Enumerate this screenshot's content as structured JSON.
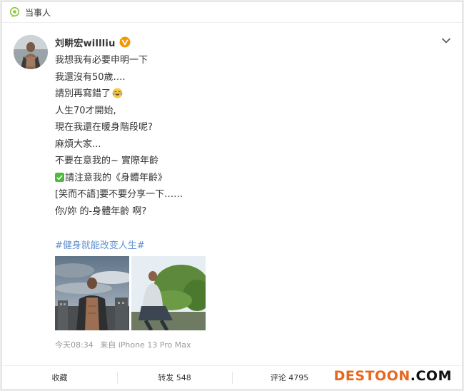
{
  "topic_bar": {
    "label": "当事人",
    "icon": "topic-icon"
  },
  "author": {
    "name": "刘畊宏willliu",
    "verified_icon": "verified-badge-icon"
  },
  "post": {
    "lines": [
      "我想我有必要申明一下",
      "我還沒有50歲….",
      "請別再寫錯了",
      "人生70才開始,",
      "現在我還在暖身階段呢?",
      "麻煩大家...",
      "不要在意我的~ 實際年齡",
      "請注意我的《身體年齡》",
      "[笑而不語]要不要分享一下……",
      "你/妳 的-身體年齡 啊?"
    ],
    "hashtag": "#健身就能改变人生#"
  },
  "meta": {
    "time": "今天08:34",
    "source": "来自 iPhone 13 Pro Max"
  },
  "actions": {
    "favorite": "收藏",
    "repost": "转发 548",
    "comment": "评论 4795",
    "like": ""
  },
  "watermark": {
    "main": "DESTOON",
    "suffix": ".COM"
  },
  "colors": {
    "hashtag": "#5e8fd0",
    "badge": "#f39800",
    "watermark": "#e8671e",
    "topic_icon": "#8cc63f"
  }
}
